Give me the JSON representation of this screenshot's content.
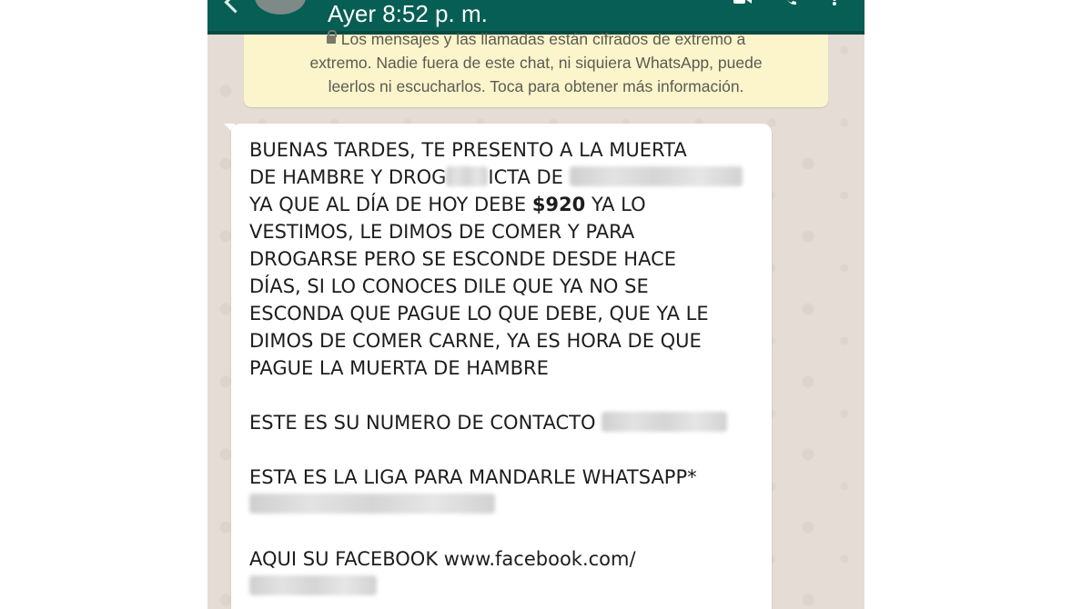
{
  "header": {
    "status": "Ayer 8:52 p. m.",
    "icons": [
      "back-arrow-icon",
      "avatar",
      "video-call-icon",
      "phone-call-icon",
      "more-options-icon"
    ],
    "color": "#075e54"
  },
  "encryption_notice": {
    "line1": "Los mensajes y las llamadas están cifrados de extremo a",
    "line2": "extremo. Nadie fuera de este chat, ni siquiera WhatsApp, puede",
    "line3": "leerlos ni escucharlos. Toca para obtener más información.",
    "icon": "lock-icon"
  },
  "message": {
    "l1": "BUENAS TARDES, TE PRESENTO A LA MUERTA",
    "l2a": "DE HAMBRE Y DROG",
    "l2b": "ICTA DE",
    "l3a": "YA QUE AL DÍA DE HOY DEBE ",
    "amount": "$920",
    "l3b": " YA LO",
    "l4": "VESTIMOS, LE DIMOS DE COMER Y PARA",
    "l5": "DROGARSE PERO SE ESCONDE DESDE HACE",
    "l6": "DÍAS, SI LO CONOCES DILE QUE YA NO SE",
    "l7": "ESCONDA QUE PAGUE LO QUE DEBE, QUE YA LE",
    "l8": "DIMOS DE COMER CARNE, YA ES HORA DE QUE",
    "l9": "PAGUE LA MUERTA DE HAMBRE",
    "l10": "ESTE ES SU NUMERO DE CONTACTO",
    "l11": "ESTA ES LA LIGA PARA MANDARLE WHATSAPP*",
    "l12": "AQUI SU FACEBOOK www.facebook.com/"
  }
}
